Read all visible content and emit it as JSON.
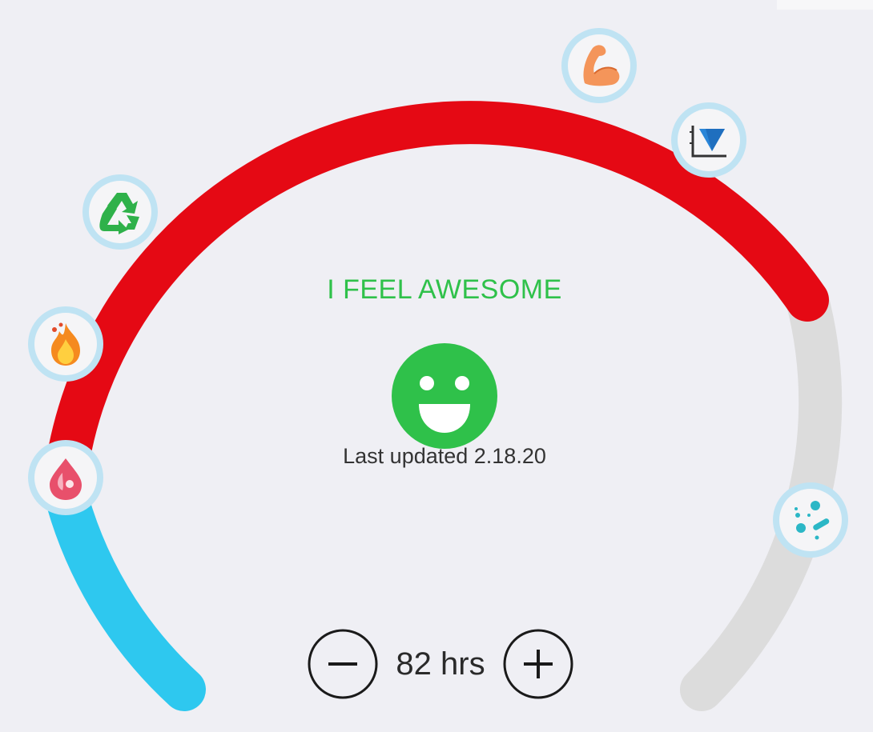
{
  "status": {
    "text": "I FEEL AWESOME",
    "mood_icon": "smiley-face-icon",
    "color": "#2fc14a"
  },
  "last_updated": {
    "text": "Last updated 2.18.20"
  },
  "fasting": {
    "hours_label": "82 hrs",
    "decrement_icon": "minus-circle-icon",
    "increment_icon": "plus-circle-icon"
  },
  "dial": {
    "colors": {
      "completed": "#e50914",
      "early": "#2ec8ef",
      "remaining": "#dcdcdc",
      "marker_ring": "#bfe3f3"
    },
    "milestones": [
      {
        "icon": "blood-sugar-drop-icon"
      },
      {
        "icon": "fat-burning-flame-icon"
      },
      {
        "icon": "recycle-icon"
      },
      {
        "icon": "muscle-arm-icon"
      },
      {
        "icon": "insulin-chart-icon"
      },
      {
        "icon": "bacteria-icon"
      }
    ]
  }
}
